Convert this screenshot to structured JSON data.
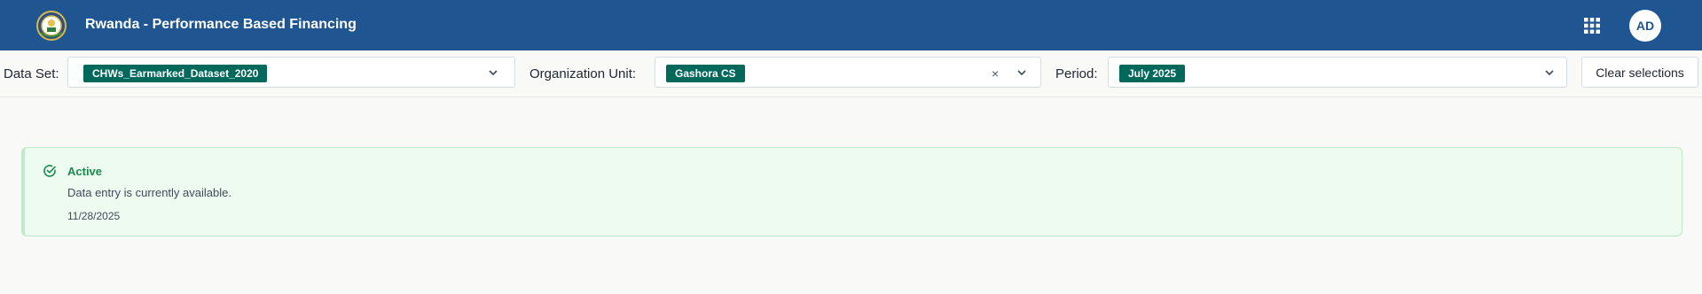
{
  "header": {
    "title": "Rwanda - Performance Based Financing",
    "logo": "rwanda-coat-of-arms",
    "apps_icon": "apps-grid-icon",
    "avatar_initials": "AD",
    "bg_color": "#1f5590"
  },
  "selection": {
    "dataset_label": "Data Set:",
    "dataset_value": "CHWs_Earmarked_Dataset_2020",
    "org_unit_label": "Organization Unit:",
    "org_unit_value": "Gashora CS",
    "org_unit_clear": "×",
    "period_label": "Period:",
    "period_value": "July 2025",
    "clear_button": "Clear selections",
    "chip_color": "#00695c"
  },
  "notice": {
    "status": "Active",
    "message": "Data entry is currently available.",
    "date": "11/28/2025",
    "icon": "check-circle-icon",
    "status_color": "#1a8b4c"
  }
}
